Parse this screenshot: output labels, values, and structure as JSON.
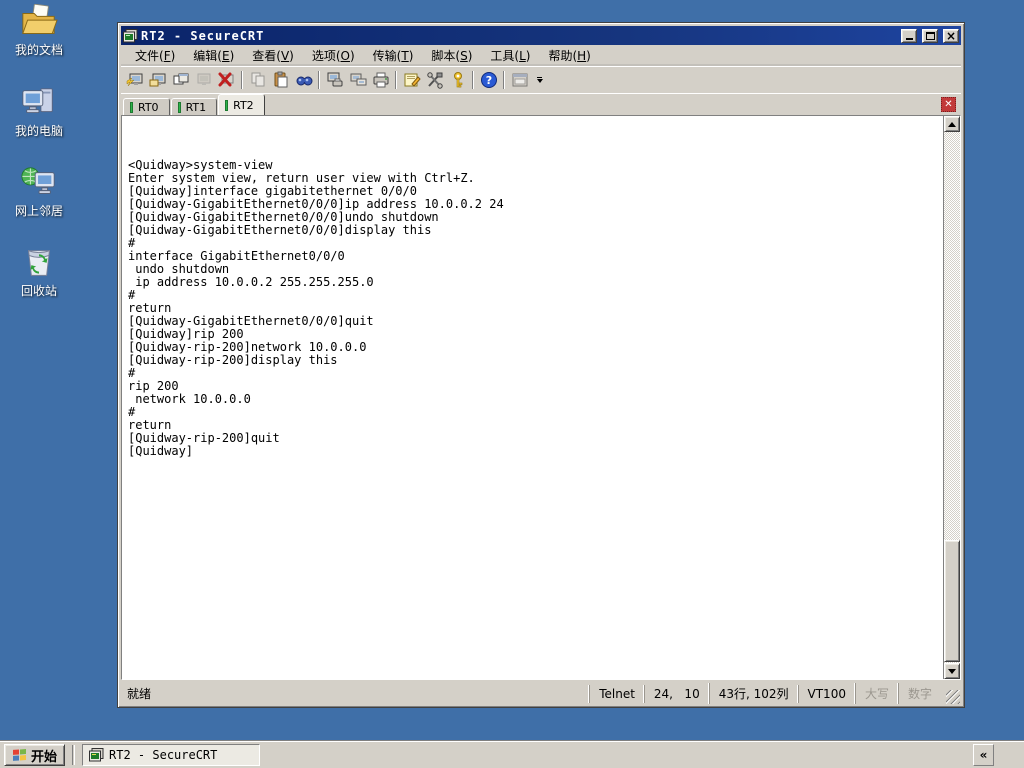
{
  "desktop": {
    "icons": [
      {
        "name": "my-documents",
        "label": "我的文档"
      },
      {
        "name": "my-computer",
        "label": "我的电脑"
      },
      {
        "name": "network-places",
        "label": "网上邻居"
      },
      {
        "name": "recycle-bin",
        "label": "回收站"
      }
    ]
  },
  "window": {
    "title": "RT2 - SecureCRT",
    "controls": {
      "minimize": "minimize",
      "maximize": "maximize",
      "close": "×"
    },
    "menu": {
      "items": [
        {
          "pre": "文件(",
          "key": "F",
          "post": ")"
        },
        {
          "pre": "编辑(",
          "key": "E",
          "post": ")"
        },
        {
          "pre": "查看(",
          "key": "V",
          "post": ")"
        },
        {
          "pre": "选项(",
          "key": "O",
          "post": ")"
        },
        {
          "pre": "传输(",
          "key": "T",
          "post": ")"
        },
        {
          "pre": "脚本(",
          "key": "S",
          "post": ")"
        },
        {
          "pre": "工具(",
          "key": "L",
          "post": ")"
        },
        {
          "pre": "帮助(",
          "key": "H",
          "post": ")"
        }
      ]
    },
    "toolbar": {
      "icons": [
        "quick-connect-icon",
        "connect-icon",
        "connect-in-tab-icon",
        "reconnect-icon",
        "disconnect-icon",
        "copy-icon",
        "paste-icon",
        "find-icon",
        "print-setup-icon",
        "print-preview-icon",
        "print-icon",
        "session-options-icon",
        "global-options-icon",
        "keymap-icon",
        "help-icon",
        "command-window-icon",
        "toolbar-overflow-icon"
      ]
    },
    "tabs": {
      "items": [
        {
          "label": "RT0",
          "active": false
        },
        {
          "label": "RT1",
          "active": false
        },
        {
          "label": "RT2",
          "active": true
        }
      ]
    },
    "terminal": {
      "lines": [
        "<Quidway>system-view",
        "Enter system view, return user view with Ctrl+Z.",
        "[Quidway]interface gigabitethernet 0/0/0",
        "[Quidway-GigabitEthernet0/0/0]ip address 10.0.0.2 24",
        "[Quidway-GigabitEthernet0/0/0]undo shutdown",
        "[Quidway-GigabitEthernet0/0/0]display this",
        "#",
        "interface GigabitEthernet0/0/0",
        " undo shutdown",
        " ip address 10.0.0.2 255.255.255.0",
        "#",
        "return",
        "[Quidway-GigabitEthernet0/0/0]quit",
        "[Quidway]rip 200",
        "[Quidway-rip-200]network 10.0.0.0",
        "[Quidway-rip-200]display this",
        "#",
        "rip 200",
        " network 10.0.0.0",
        "#",
        "return",
        "[Quidway-rip-200]quit",
        "[Quidway]"
      ]
    },
    "statusbar": {
      "ready": "就绪",
      "panels": [
        {
          "label": "Telnet",
          "disabled": false
        },
        {
          "label": "24,   10",
          "disabled": false
        },
        {
          "label": "43行, 102列",
          "disabled": false
        },
        {
          "label": "VT100",
          "disabled": false
        },
        {
          "label": "大写",
          "disabled": true
        },
        {
          "label": "数字",
          "disabled": true
        }
      ]
    }
  },
  "taskbar": {
    "start_label": "开始",
    "task_label": "RT2 - SecureCRT",
    "tray_collapse": "«"
  },
  "colors": {
    "desktop_bg": "#3F6FA8",
    "titlebar_start": "#0A246A",
    "titlebar_end": "#1E44A0",
    "chrome": "#D4D0C8",
    "tab_indicator_green": "#2DB44A",
    "tab_close_red": "#C23A3A",
    "terminal_bg": "#FFFFFF",
    "terminal_fg": "#000000"
  }
}
